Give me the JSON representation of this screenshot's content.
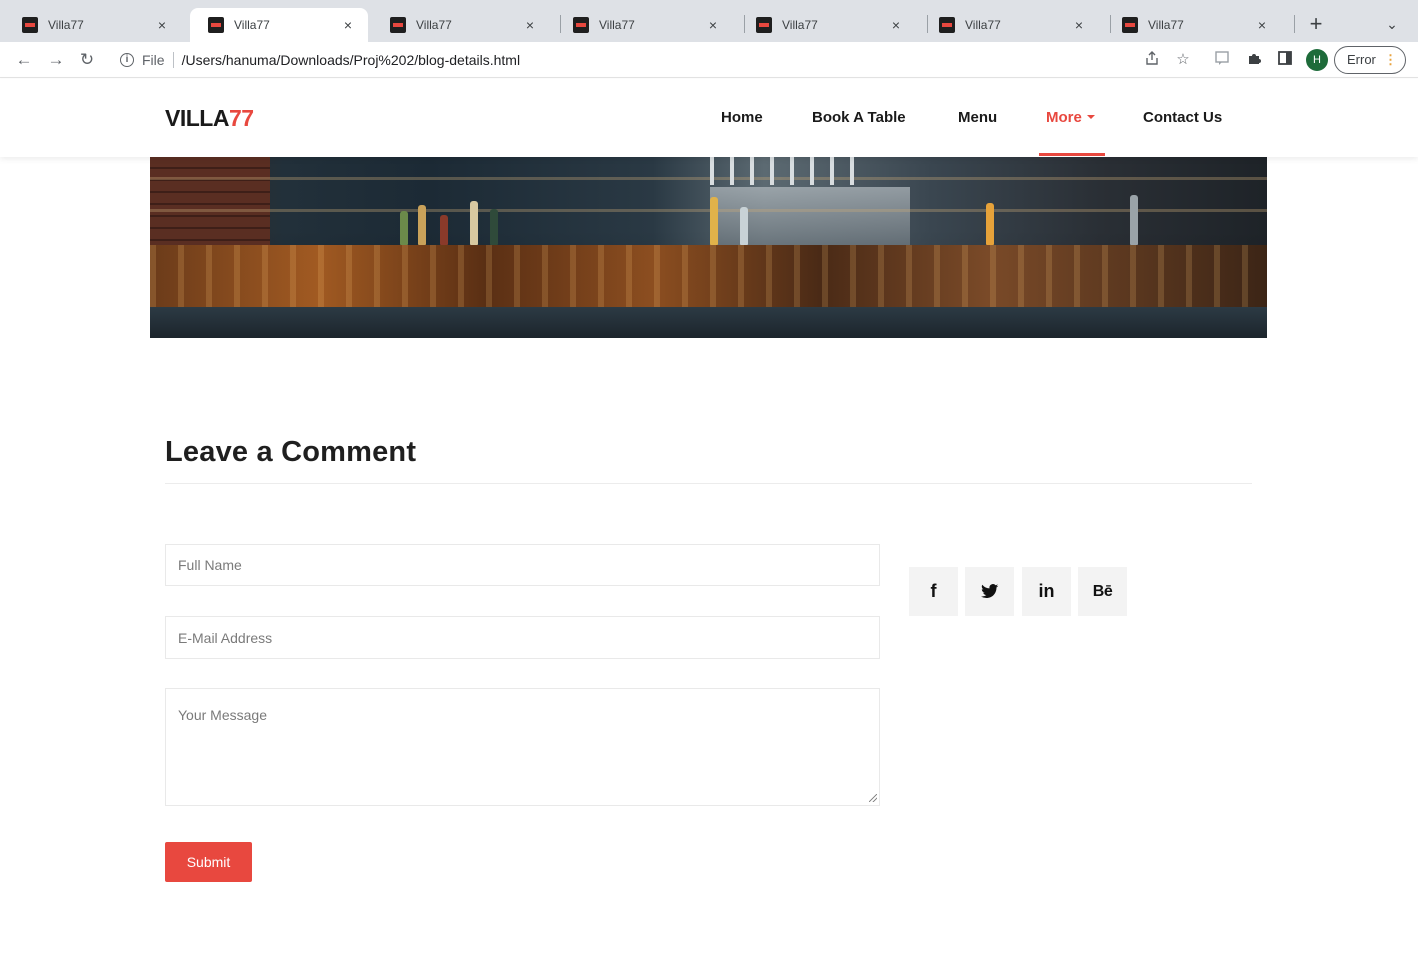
{
  "browser": {
    "tabs": [
      {
        "title": "Villa77",
        "active": false
      },
      {
        "title": "Villa77",
        "active": true
      },
      {
        "title": "Villa77",
        "active": false
      },
      {
        "title": "Villa77",
        "active": false
      },
      {
        "title": "Villa77",
        "active": false
      },
      {
        "title": "Villa77",
        "active": false
      },
      {
        "title": "Villa77",
        "active": false
      }
    ],
    "tab_close_glyph": "×",
    "new_tab_glyph": "+",
    "tab_menu_glyph": "⌄",
    "nav_back_glyph": "←",
    "nav_forward_glyph": "→",
    "reload_glyph": "↻",
    "address": {
      "scheme_label": "File",
      "url": "/Users/hanuma/Downloads/Proj%202/blog-details.html"
    },
    "profile_initial": "H",
    "error_label": "Error",
    "error_dots": "⋮"
  },
  "site": {
    "logo": {
      "main": "VILLA",
      "accent": "77"
    },
    "nav": {
      "home": "Home",
      "book": "Book A Table",
      "menu": "Menu",
      "more": "More",
      "contact": "Contact Us"
    },
    "accent_color": "#e8483f"
  },
  "comment_form": {
    "title": "Leave a Comment",
    "full_name_placeholder": "Full Name",
    "email_placeholder": "E-Mail Address",
    "message_placeholder": "Your Message",
    "submit_label": "Submit"
  },
  "social": {
    "facebook": "f",
    "twitter": "🐦",
    "linkedin": "in",
    "behance": "Bē"
  }
}
